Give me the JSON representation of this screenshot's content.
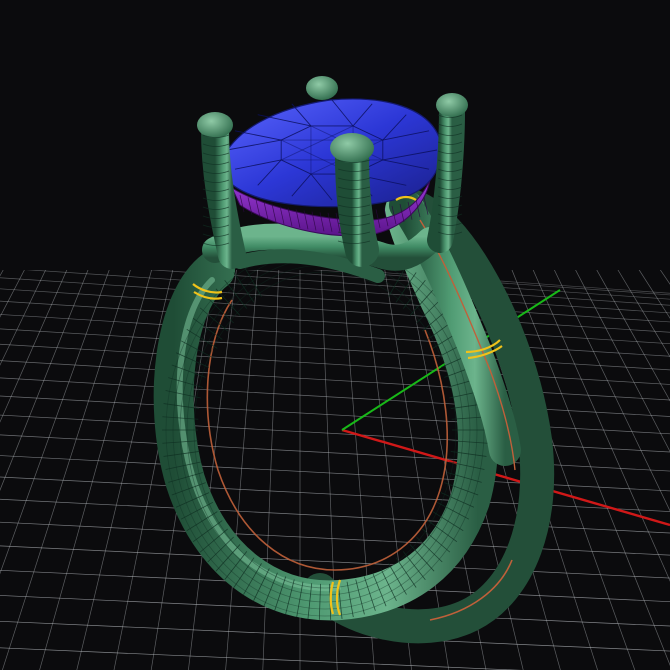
{
  "viewport": {
    "background": "#0b0b0d",
    "grid_color": "#bfc3c8",
    "axis_x_color": "#d01818",
    "axis_y_color": "#18b818"
  },
  "model": {
    "metal_color": "#3f8a64",
    "metal_light": "#69b38a",
    "metal_dark": "#1f4d36",
    "wire_color": "#0f2f22",
    "gem_top_color": "#2c37d6",
    "gem_top_light": "#5b66ff",
    "gem_pavilion_color": "#7b1fb8",
    "seam_color": "#f0c21a",
    "edge_color": "#c0603a",
    "prong_count": 4
  }
}
